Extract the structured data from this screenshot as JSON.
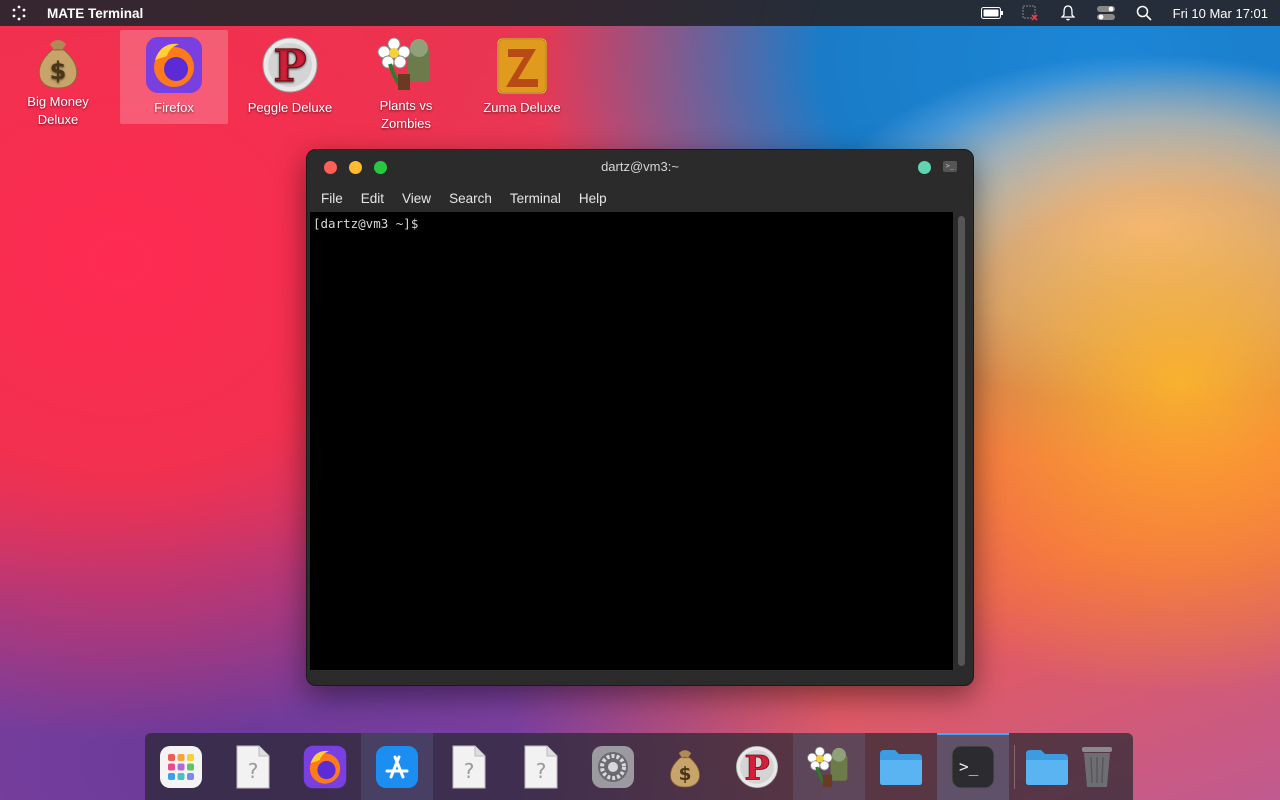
{
  "top_panel": {
    "app_title": "MATE Terminal",
    "clock": "Fri 10 Mar 17:01",
    "icons": [
      "menu-icon",
      "battery-icon",
      "network-icon",
      "bell-icon",
      "toggle-icon",
      "search-icon"
    ]
  },
  "desktop_icons": [
    {
      "label": "Big Money\nDeluxe",
      "icon": "money-bag-icon"
    },
    {
      "label": "Firefox",
      "icon": "firefox-icon",
      "selected": true
    },
    {
      "label": "Peggle Deluxe",
      "icon": "peggle-icon"
    },
    {
      "label": "Plants vs\nZombies",
      "icon": "plants-icon"
    },
    {
      "label": "Zuma Deluxe",
      "icon": "zuma-icon"
    }
  ],
  "terminal_window": {
    "title": "dartz@vm3:~",
    "menu": [
      "File",
      "Edit",
      "View",
      "Search",
      "Terminal",
      "Help"
    ],
    "prompt": "[dartz@vm3 ~]$"
  },
  "dock": {
    "items": [
      "app-grid-icon",
      "unknown-file-icon",
      "firefox-icon",
      "app-store-icon",
      "unknown-file-icon",
      "unknown-file-icon",
      "settings-gear-icon",
      "money-bag-icon",
      "peggle-icon",
      "plants-icon",
      "folder-icon",
      "terminal-icon",
      "folder-icon",
      "trash-icon"
    ]
  }
}
